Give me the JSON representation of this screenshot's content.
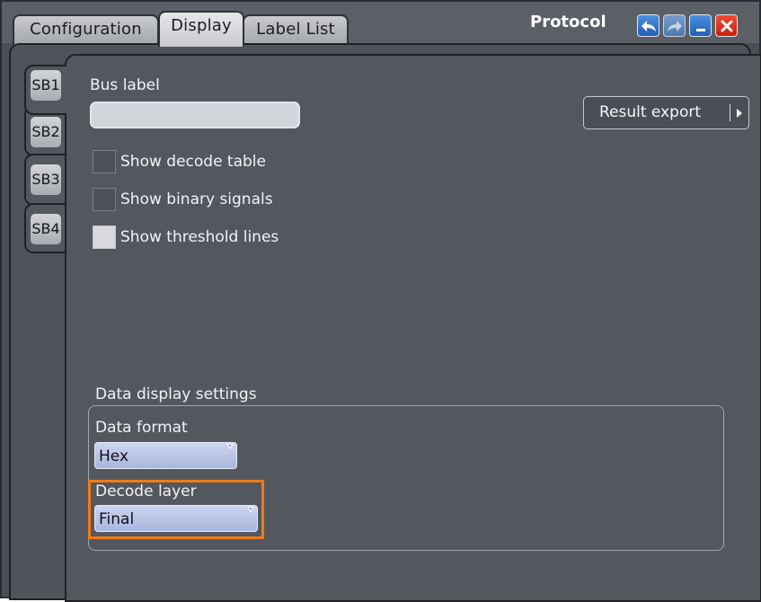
{
  "window": {
    "title": "Protocol",
    "tabs": [
      {
        "label": "Configuration",
        "active": false
      },
      {
        "label": "Display",
        "active": true
      },
      {
        "label": "Label List",
        "active": false
      }
    ],
    "controls": [
      "undo-icon",
      "redo-icon",
      "minimize-icon",
      "close-icon"
    ]
  },
  "side_tabs": [
    {
      "label": "SB1",
      "active": true
    },
    {
      "label": "SB2",
      "active": false
    },
    {
      "label": "SB3",
      "active": false
    },
    {
      "label": "SB4",
      "active": false
    }
  ],
  "bus_label": {
    "label": "Bus label",
    "value": ""
  },
  "result_export": {
    "label": "Result export"
  },
  "checkboxes": [
    {
      "label": "Show decode table",
      "checked": false
    },
    {
      "label": "Show binary signals",
      "checked": false
    },
    {
      "label": "Show threshold lines",
      "checked": true
    }
  ],
  "data_display": {
    "title": "Data display settings",
    "data_format": {
      "label": "Data format",
      "value": "Hex"
    },
    "decode_layer": {
      "label": "Decode layer",
      "value": "Final"
    }
  },
  "colors": {
    "background": "#4a4f55",
    "accent_highlight": "#f07a1a",
    "close_button": "#e3301f",
    "window_button": "#2d77c9",
    "select_fill": "#b7c3e6"
  }
}
